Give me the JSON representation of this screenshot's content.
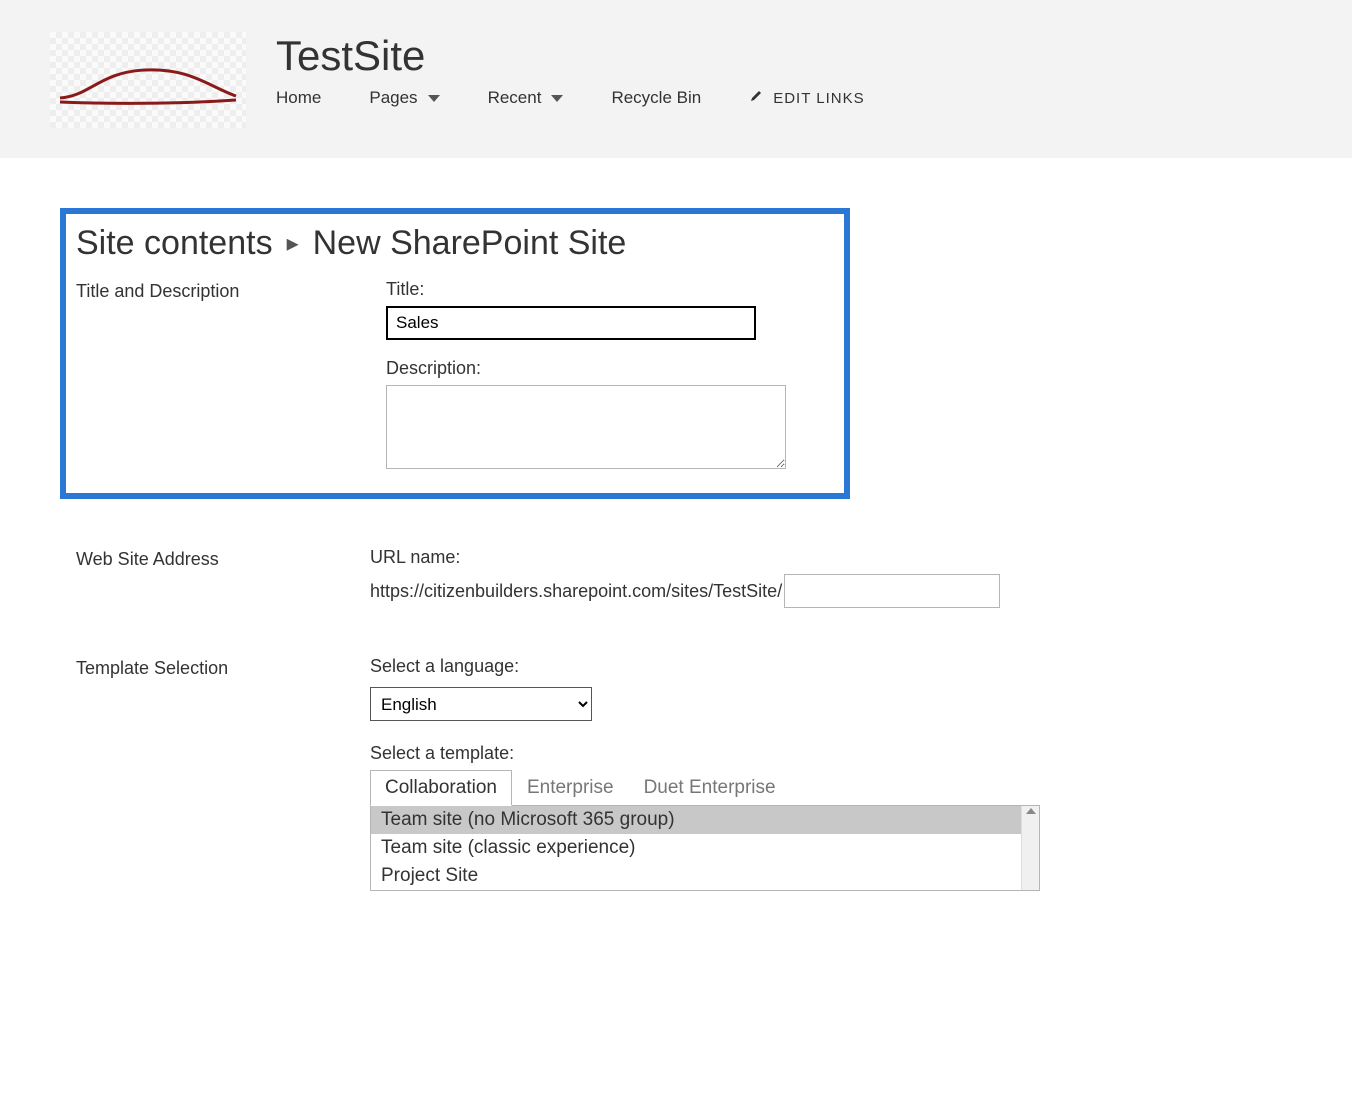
{
  "header": {
    "site_title": "TestSite",
    "nav": {
      "home": "Home",
      "pages": "Pages",
      "recent": "Recent",
      "recycle_bin": "Recycle Bin",
      "edit_links": "EDIT LINKS"
    }
  },
  "breadcrumb": {
    "parent": "Site contents",
    "current": "New SharePoint Site"
  },
  "sections": {
    "title_desc": {
      "heading": "Title and Description",
      "title_label": "Title:",
      "title_value": "Sales",
      "desc_label": "Description:",
      "desc_value": ""
    },
    "address": {
      "heading": "Web Site Address",
      "url_label": "URL name:",
      "url_prefix": "https://citizenbuilders.sharepoint.com/sites/TestSite/",
      "url_value": ""
    },
    "template": {
      "heading": "Template Selection",
      "lang_label": "Select a language:",
      "lang_value": "English",
      "tmpl_label": "Select a template:",
      "tabs": {
        "collab": "Collaboration",
        "enterprise": "Enterprise",
        "duet": "Duet Enterprise"
      },
      "items": {
        "t0": "Team site (no Microsoft 365 group)",
        "t1": "Team site (classic experience)",
        "t2": "Project Site"
      }
    }
  }
}
